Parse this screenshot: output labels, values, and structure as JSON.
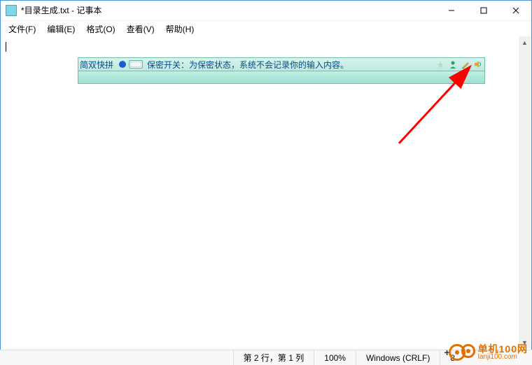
{
  "window": {
    "title": "*目录生成.txt - 记事本"
  },
  "menu": {
    "file": "文件(F)",
    "edit": "编辑(E)",
    "format": "格式(O)",
    "view": "查看(V)",
    "help": "帮助(H)"
  },
  "ime": {
    "mode": "简双快拼",
    "message": "保密开关：为保密状态，系统不会记录你的输入内容。"
  },
  "status": {
    "position": "第 2 行，第 1 列",
    "zoom": "100%",
    "lineending": "Windows (CRLF)",
    "encoding_partial": "8"
  },
  "watermark": {
    "brand": "单机100网",
    "url": "lanji100.com"
  }
}
